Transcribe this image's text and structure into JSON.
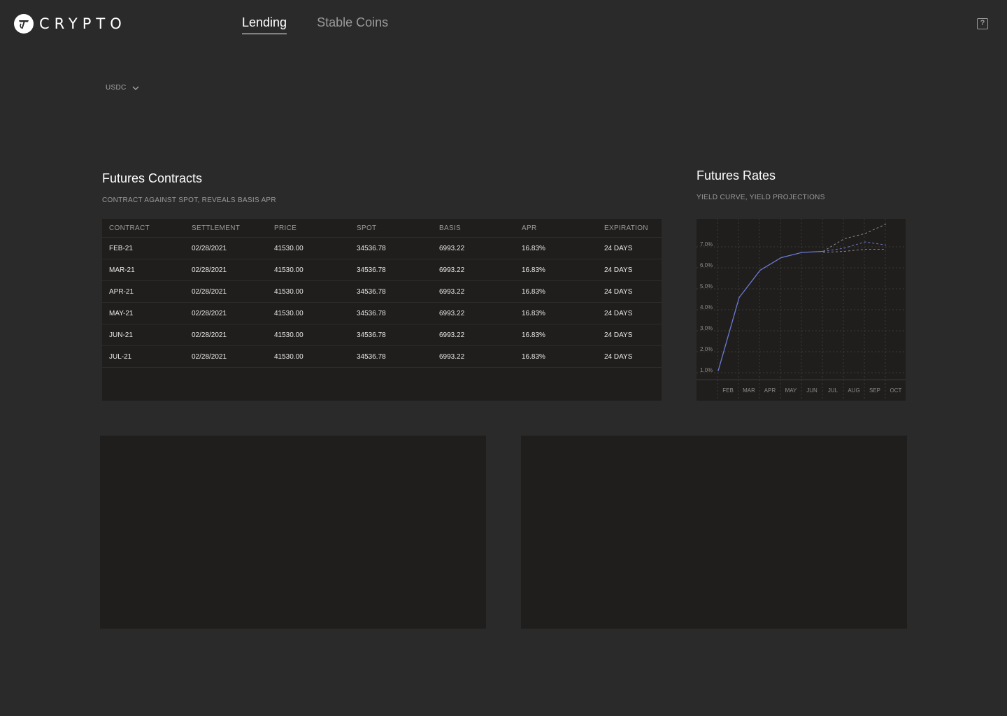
{
  "brand": {
    "name": "CRYPTO",
    "logo_icon": "crypto-logo-icon"
  },
  "nav": {
    "tabs": [
      {
        "label": "Lending",
        "active": true
      },
      {
        "label": "Stable Coins",
        "active": false
      }
    ],
    "help_label": "?"
  },
  "coin_select": {
    "value": "USDC"
  },
  "futures_contracts": {
    "title": "Futures Contracts",
    "subtitle": "CONTRACT AGAINST SPOT, REVEALS BASIS APR",
    "columns": [
      "CONTRACT",
      "SETTLEMENT",
      "PRICE",
      "SPOT",
      "BASIS",
      "APR",
      "EXPIRATION"
    ],
    "rows": [
      [
        "FEB-21",
        "02/28/2021",
        "41530.00",
        "34536.78",
        "6993.22",
        "16.83%",
        "24 DAYS"
      ],
      [
        "MAR-21",
        "02/28/2021",
        "41530.00",
        "34536.78",
        "6993.22",
        "16.83%",
        "24 DAYS"
      ],
      [
        "APR-21",
        "02/28/2021",
        "41530.00",
        "34536.78",
        "6993.22",
        "16.83%",
        "24 DAYS"
      ],
      [
        "MAY-21",
        "02/28/2021",
        "41530.00",
        "34536.78",
        "6993.22",
        "16.83%",
        "24 DAYS"
      ],
      [
        "JUN-21",
        "02/28/2021",
        "41530.00",
        "34536.78",
        "6993.22",
        "16.83%",
        "24 DAYS"
      ],
      [
        "JUL-21",
        "02/28/2021",
        "41530.00",
        "34536.78",
        "6993.22",
        "16.83%",
        "24 DAYS"
      ]
    ]
  },
  "futures_rates": {
    "title": "Futures Rates",
    "subtitle": "YIELD CURVE, YIELD PROJECTIONS"
  },
  "colors": {
    "background": "#2a2a2a",
    "panel": "#201e1c",
    "line": "#6b7bd6",
    "projection_gray": "#8a8a8a"
  },
  "chart_data": {
    "type": "line",
    "categories": [
      "FEB",
      "MAR",
      "APR",
      "MAY",
      "JUN",
      "JUL",
      "AUG",
      "SEP",
      "OCT"
    ],
    "y_ticks": [
      "1.0%",
      "2.0%",
      "3.0%",
      "4.0%",
      "5.0%",
      "6.0%",
      "7.0%"
    ],
    "ylim": [
      0.2,
      8.0
    ],
    "grid": true,
    "series": [
      {
        "style": "solid",
        "x": [
          0,
          1,
          2,
          3,
          4,
          5
        ],
        "values": [
          0.95,
          4.45,
          5.75,
          6.35,
          6.6,
          6.65
        ]
      },
      {
        "style": "dashed",
        "color": "gray",
        "x": [
          5,
          6,
          7,
          8
        ],
        "values": [
          6.65,
          7.25,
          7.5,
          7.95
        ]
      },
      {
        "style": "dashed",
        "color": "blue",
        "x": [
          5,
          6,
          7,
          8
        ],
        "values": [
          6.65,
          6.8,
          7.1,
          6.95
        ]
      },
      {
        "style": "dashed",
        "color": "gray",
        "x": [
          5,
          6,
          7,
          8
        ],
        "values": [
          6.6,
          6.65,
          6.75,
          6.75
        ]
      }
    ]
  }
}
